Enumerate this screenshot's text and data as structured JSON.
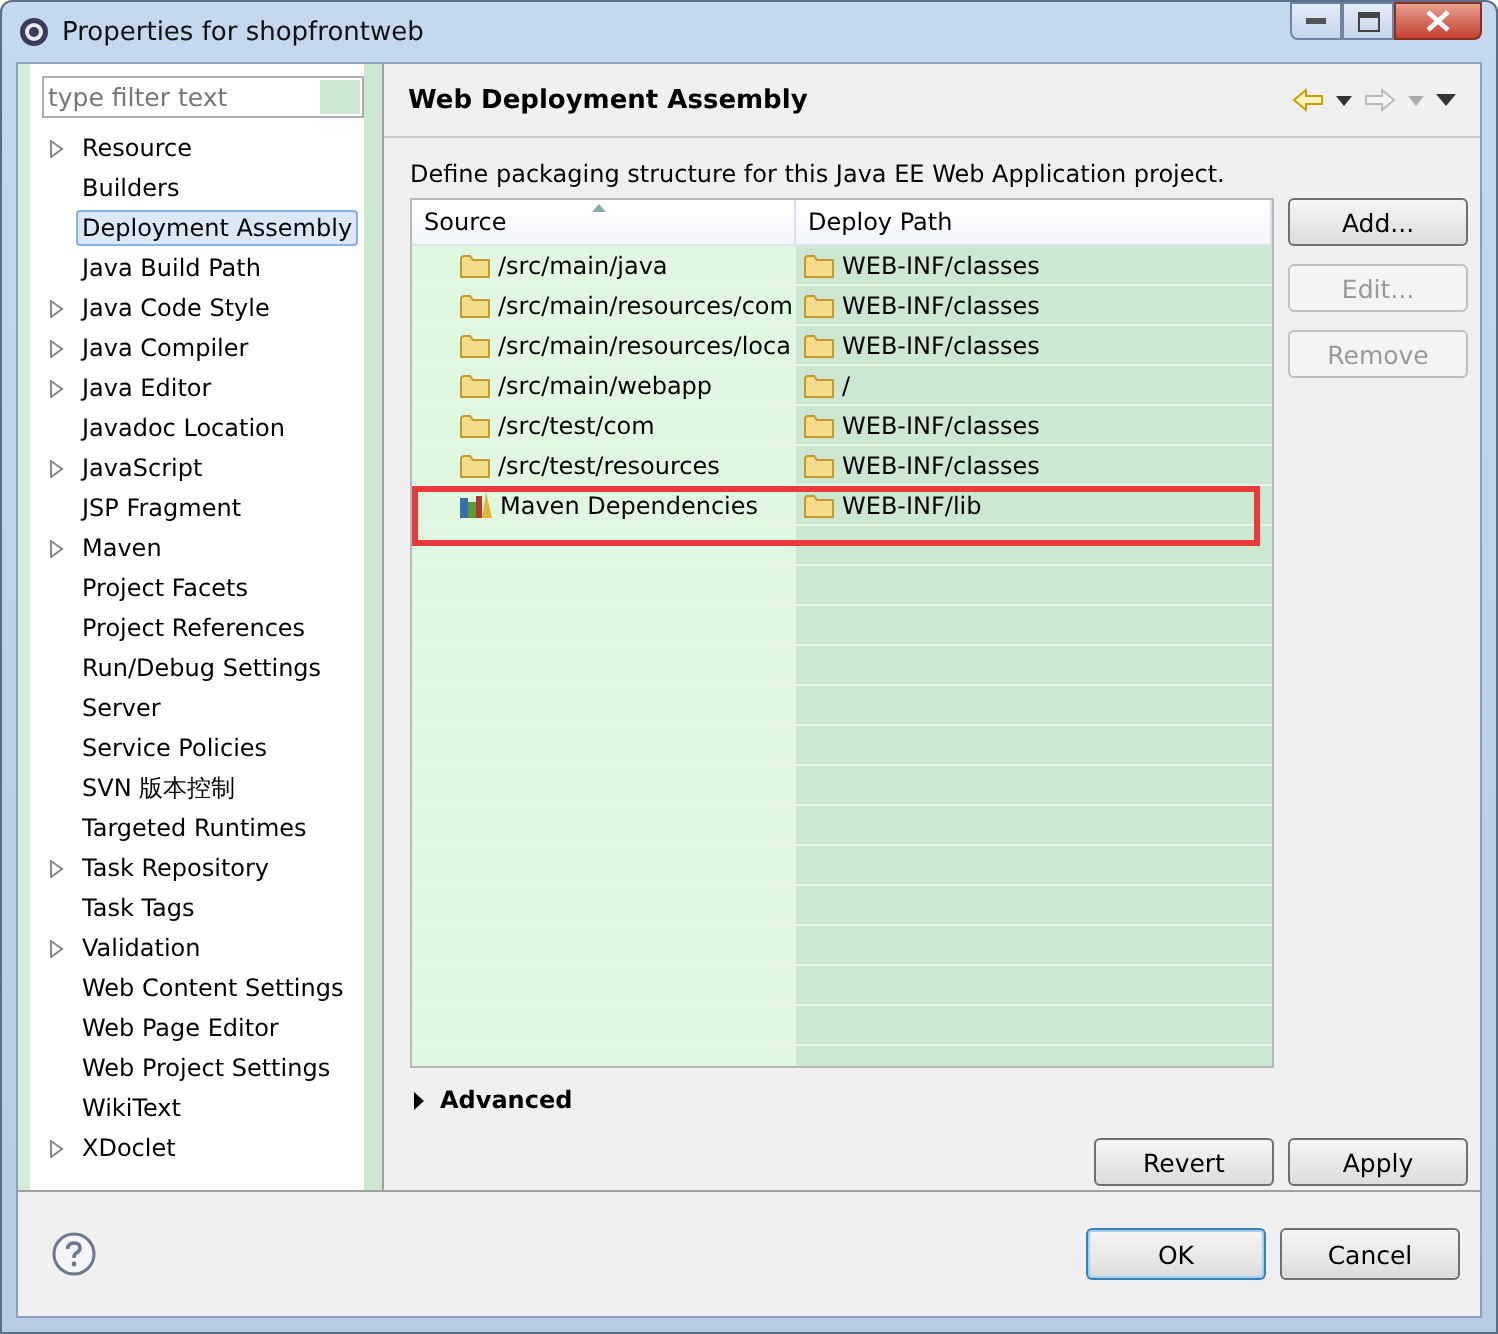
{
  "window": {
    "title": "Properties for shopfrontweb"
  },
  "filter": {
    "placeholder": "type filter text"
  },
  "tree": [
    {
      "label": "Resource",
      "expandable": true,
      "selected": false
    },
    {
      "label": "Builders",
      "expandable": false,
      "selected": false
    },
    {
      "label": "Deployment Assembly",
      "expandable": false,
      "selected": true
    },
    {
      "label": "Java Build Path",
      "expandable": false,
      "selected": false
    },
    {
      "label": "Java Code Style",
      "expandable": true,
      "selected": false
    },
    {
      "label": "Java Compiler",
      "expandable": true,
      "selected": false
    },
    {
      "label": "Java Editor",
      "expandable": true,
      "selected": false
    },
    {
      "label": "Javadoc Location",
      "expandable": false,
      "selected": false
    },
    {
      "label": "JavaScript",
      "expandable": true,
      "selected": false
    },
    {
      "label": "JSP Fragment",
      "expandable": false,
      "selected": false
    },
    {
      "label": "Maven",
      "expandable": true,
      "selected": false
    },
    {
      "label": "Project Facets",
      "expandable": false,
      "selected": false
    },
    {
      "label": "Project References",
      "expandable": false,
      "selected": false
    },
    {
      "label": "Run/Debug Settings",
      "expandable": false,
      "selected": false
    },
    {
      "label": "Server",
      "expandable": false,
      "selected": false
    },
    {
      "label": "Service Policies",
      "expandable": false,
      "selected": false
    },
    {
      "label": "SVN 版本控制",
      "expandable": false,
      "selected": false
    },
    {
      "label": "Targeted Runtimes",
      "expandable": false,
      "selected": false
    },
    {
      "label": "Task Repository",
      "expandable": true,
      "selected": false
    },
    {
      "label": "Task Tags",
      "expandable": false,
      "selected": false
    },
    {
      "label": "Validation",
      "expandable": true,
      "selected": false
    },
    {
      "label": "Web Content Settings",
      "expandable": false,
      "selected": false
    },
    {
      "label": "Web Page Editor",
      "expandable": false,
      "selected": false
    },
    {
      "label": "Web Project Settings",
      "expandable": false,
      "selected": false
    },
    {
      "label": "WikiText",
      "expandable": false,
      "selected": false
    },
    {
      "label": "XDoclet",
      "expandable": true,
      "selected": false
    }
  ],
  "page": {
    "title": "Web Deployment Assembly",
    "description": "Define packaging structure for this Java EE Web Application project."
  },
  "table": {
    "columns": [
      "Source",
      "Deploy Path"
    ],
    "rows": [
      {
        "source": "/src/main/java",
        "kind": "folder",
        "deploy_path": "WEB-INF/classes",
        "highlighted": false
      },
      {
        "source": "/src/main/resources/com",
        "kind": "folder",
        "deploy_path": "WEB-INF/classes",
        "highlighted": false
      },
      {
        "source": "/src/main/resources/loca",
        "kind": "folder",
        "deploy_path": "WEB-INF/classes",
        "highlighted": false
      },
      {
        "source": "/src/main/webapp",
        "kind": "folder",
        "deploy_path": "/",
        "highlighted": false
      },
      {
        "source": "/src/test/com",
        "kind": "folder",
        "deploy_path": "WEB-INF/classes",
        "highlighted": false
      },
      {
        "source": "/src/test/resources",
        "kind": "folder",
        "deploy_path": "WEB-INF/classes",
        "highlighted": false
      },
      {
        "source": "Maven Dependencies",
        "kind": "library",
        "deploy_path": "WEB-INF/lib",
        "highlighted": true
      }
    ]
  },
  "side_buttons": [
    {
      "label": "Add...",
      "disabled": false
    },
    {
      "label": "Edit...",
      "disabled": true
    },
    {
      "label": "Remove",
      "disabled": true
    }
  ],
  "advanced": {
    "label": "Advanced",
    "expanded": false
  },
  "page_buttons": [
    "Revert",
    "Apply"
  ],
  "dialog_buttons": [
    {
      "label": "OK",
      "default": true
    },
    {
      "label": "Cancel",
      "default": false
    }
  ]
}
